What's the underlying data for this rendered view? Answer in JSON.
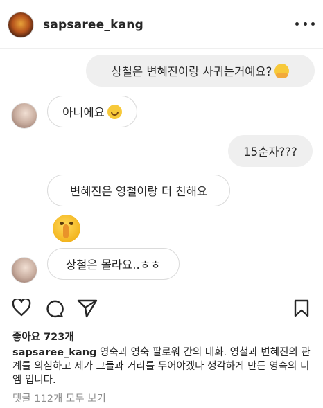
{
  "header": {
    "username": "sapsaree_kang",
    "more_icon": "more-horizontal-icon"
  },
  "messages": [
    {
      "from": "me",
      "text": "상철은 변혜진이랑 사귀는거예요?",
      "emoji": "hugging-face-emoji"
    },
    {
      "from": "them",
      "text": "아니에요",
      "emoji": "smiling-face-emoji"
    },
    {
      "from": "me",
      "text": "15순자???"
    },
    {
      "from": "them",
      "text": "변혜진은 영철이랑 더 친해요"
    },
    {
      "from": "them",
      "emoji": "shushing-face-emoji"
    },
    {
      "from": "them",
      "text": "상철은 몰라요..ㅎㅎ"
    }
  ],
  "actions": {
    "like_icon": "heart-icon",
    "comment_icon": "comment-icon",
    "share_icon": "send-icon",
    "save_icon": "bookmark-icon"
  },
  "post": {
    "likes_text": "좋아요 723개",
    "caption_username": "sapsaree_kang",
    "caption_text": "영숙과 영숙 팔로워 간의 대화. 영철과 변혜진의 관계를 의심하고 제가 그들과 거리를 두어야겠다 생각하게 만든 영숙의 디엠 입니다.",
    "comments_link": "댓글 112개 모두 보기"
  }
}
